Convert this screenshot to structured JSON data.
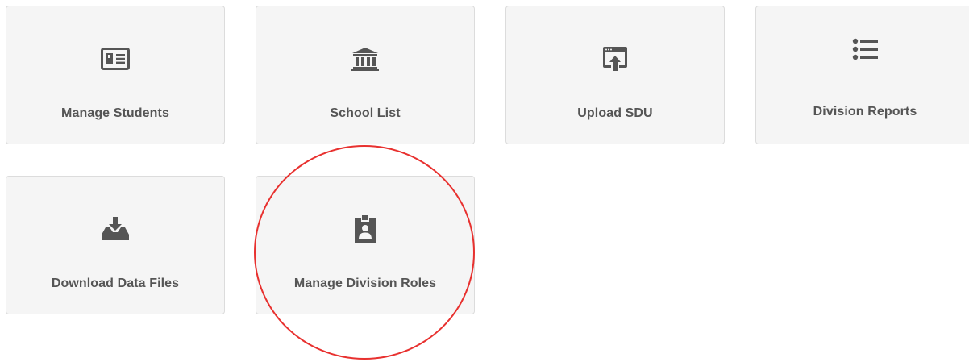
{
  "tiles": [
    {
      "label": "Manage Students",
      "icon": "id-card-icon"
    },
    {
      "label": "School List",
      "icon": "institution-icon"
    },
    {
      "label": "Upload SDU",
      "icon": "upload-window-icon"
    },
    {
      "label": "Division Reports",
      "icon": "list-icon"
    },
    {
      "label": "Download Data Files",
      "icon": "download-tray-icon"
    },
    {
      "label": "Manage Division Roles",
      "icon": "badge-user-icon"
    }
  ],
  "colors": {
    "tile_background": "#f5f5f5",
    "tile_border": "#dcdcdc",
    "text": "#555555",
    "icon": "#555555",
    "highlight": "#e8312f"
  }
}
